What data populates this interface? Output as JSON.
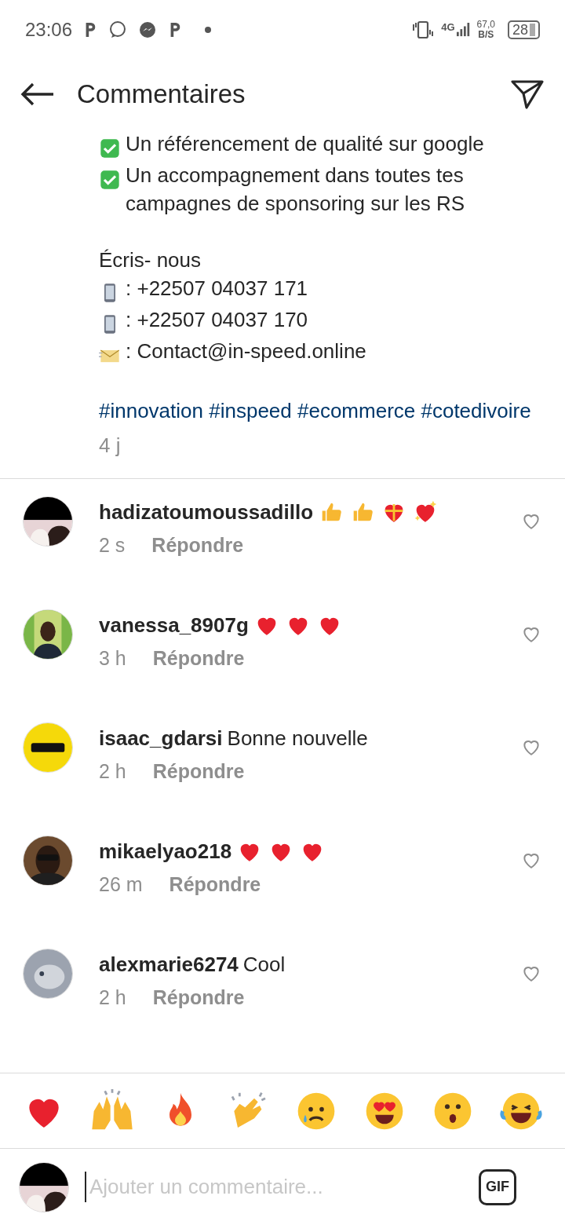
{
  "status_bar": {
    "time": "23:06",
    "network": "4G",
    "speed": "67,0",
    "speed_unit": "B/S",
    "battery": "28"
  },
  "header": {
    "title": "Commentaires"
  },
  "post": {
    "lines": [
      {
        "kind": "check",
        "text": "Un référencement de qualité sur google"
      },
      {
        "kind": "check",
        "text": "Un accompagnement dans toutes tes campagnes de sponsoring sur les RS"
      },
      {
        "kind": "blank"
      },
      {
        "kind": "plain",
        "text": "Écris- nous"
      },
      {
        "kind": "phone",
        "text": ": +22507 04037 171"
      },
      {
        "kind": "phone",
        "text": ": +22507 04037 170"
      },
      {
        "kind": "mail",
        "text": ": Contact@in-speed.online"
      },
      {
        "kind": "blank"
      },
      {
        "kind": "hashtags",
        "text": "#innovation #inspeed #ecommerce #cotedivoire"
      }
    ],
    "time": "4 j"
  },
  "comments": [
    {
      "username": "hadizatoumoussadillo",
      "reactions": [
        {
          "kind": "thumbs_up"
        },
        {
          "kind": "thumbs_up"
        },
        {
          "kind": "gift_heart"
        },
        {
          "kind": "sparkle_heart"
        }
      ],
      "time": "2 s",
      "reply": "Répondre"
    },
    {
      "username": "vanessa_8907g",
      "reactions": [
        {
          "kind": "heart"
        },
        {
          "kind": "heart"
        },
        {
          "kind": "heart"
        }
      ],
      "time": "3 h",
      "reply": "Répondre"
    },
    {
      "username": "isaac_gdarsi",
      "text": "Bonne nouvelle",
      "time": "2 h",
      "reply": "Répondre"
    },
    {
      "username": "mikaelyao218",
      "reactions": [
        {
          "kind": "heart"
        },
        {
          "kind": "heart"
        },
        {
          "kind": "heart"
        }
      ],
      "time": "26 m",
      "reply": "Répondre"
    },
    {
      "username": "alexmarie6274",
      "text": "Cool",
      "time": "2 h",
      "reply": "Répondre"
    }
  ],
  "quick_reactions": [
    {
      "kind": "heart"
    },
    {
      "kind": "raised_hands"
    },
    {
      "kind": "fire"
    },
    {
      "kind": "clap"
    },
    {
      "kind": "sad"
    },
    {
      "kind": "heart_eyes"
    },
    {
      "kind": "surprised"
    },
    {
      "kind": "laughing"
    }
  ],
  "composer": {
    "placeholder": "Ajouter un commentaire...",
    "gif": "GIF"
  }
}
